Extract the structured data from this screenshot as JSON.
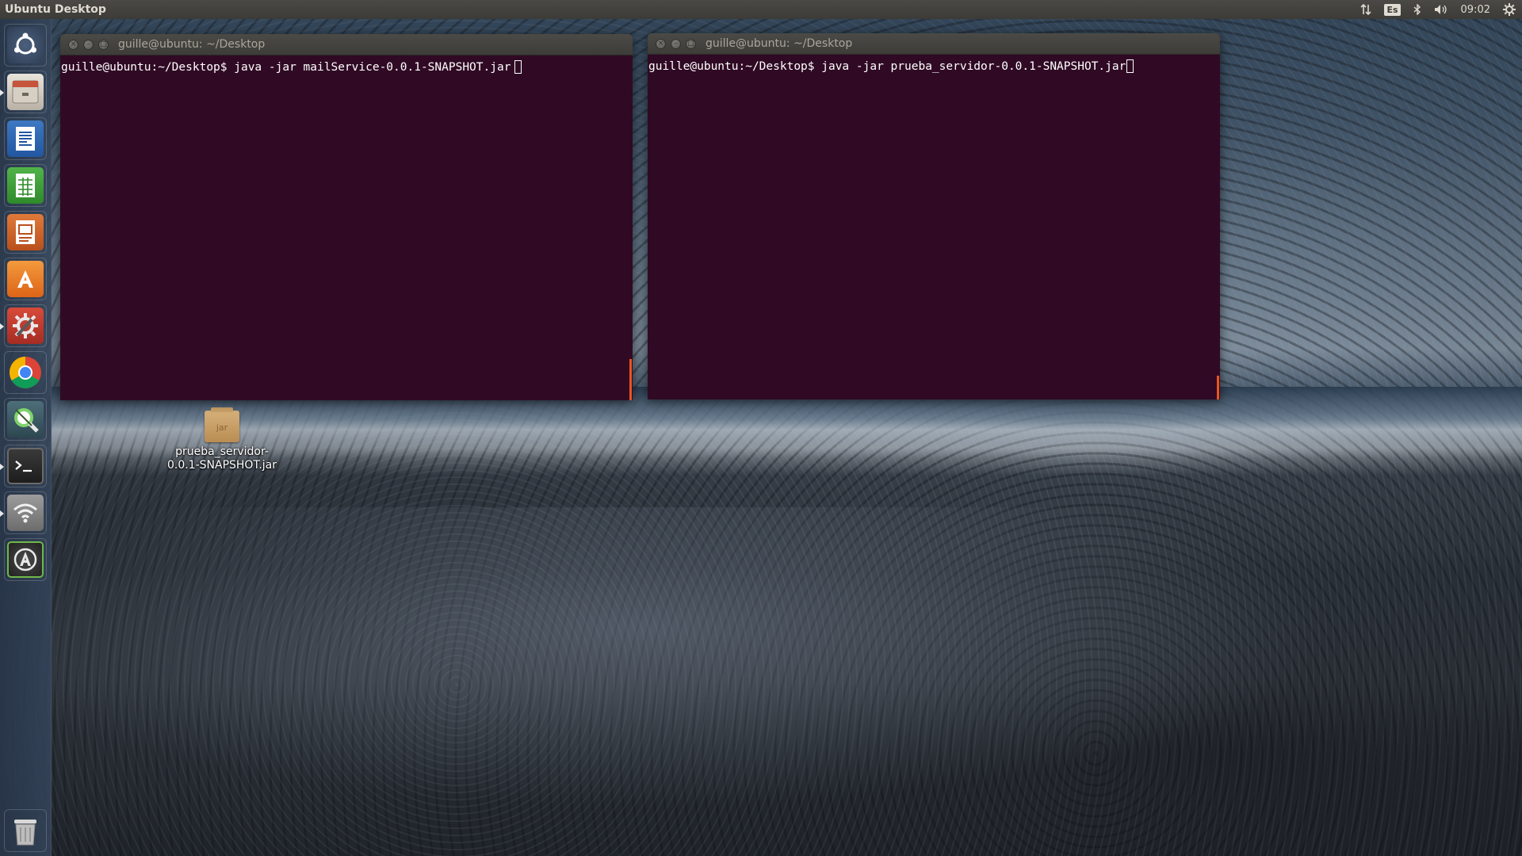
{
  "top_panel": {
    "title": "Ubuntu Desktop",
    "keyboard_layout": "Es",
    "clock": "09:02",
    "network_icon": "network-updown-icon",
    "bluetooth_icon": "bluetooth-icon",
    "volume_icon": "volume-icon",
    "system_icon": "gear-icon"
  },
  "launcher": {
    "items": [
      {
        "name": "dash",
        "icon": "ubuntu-dash-icon",
        "running": false
      },
      {
        "name": "files",
        "icon": "file-cabinet-icon",
        "running": true
      },
      {
        "name": "writer",
        "icon": "writer-document-icon",
        "running": false
      },
      {
        "name": "calc",
        "icon": "calc-spreadsheet-icon",
        "running": false
      },
      {
        "name": "impress",
        "icon": "impress-presentation-icon",
        "running": false
      },
      {
        "name": "software-center",
        "icon": "software-center-icon",
        "running": false
      },
      {
        "name": "system-settings",
        "icon": "settings-tools-icon",
        "running": true
      },
      {
        "name": "chrome",
        "icon": "chrome-icon",
        "running": false
      },
      {
        "name": "system-tool",
        "icon": "magnifier-tool-icon",
        "running": false
      },
      {
        "name": "terminal",
        "icon": "terminal-icon",
        "running": true
      },
      {
        "name": "network",
        "icon": "wifi-icon",
        "running": true
      },
      {
        "name": "updater",
        "icon": "software-updater-icon",
        "running": false
      },
      {
        "name": "trash",
        "icon": "trash-icon",
        "running": false
      }
    ]
  },
  "terminals": [
    {
      "title": "guille@ubuntu: ~/Desktop",
      "prompt": "guille@ubuntu:~/Desktop$",
      "command": " java -jar mailService-0.0.1-SNAPSHOT.jar"
    },
    {
      "title": "guille@ubuntu: ~/Desktop",
      "prompt": "guille@ubuntu:~/Desktop$",
      "command": " java -jar prueba_servidor-0.0.1-SNAPSHOT.jar"
    }
  ],
  "desktop_icon": {
    "badge": "jar",
    "label_line1": "prueba_servidor-",
    "label_line2": "0.0.1-SNAPSHOT.jar"
  },
  "colors": {
    "terminal_bg": "#300a24",
    "accent_orange": "#e95420",
    "panel_bg": "#3c3b37"
  }
}
